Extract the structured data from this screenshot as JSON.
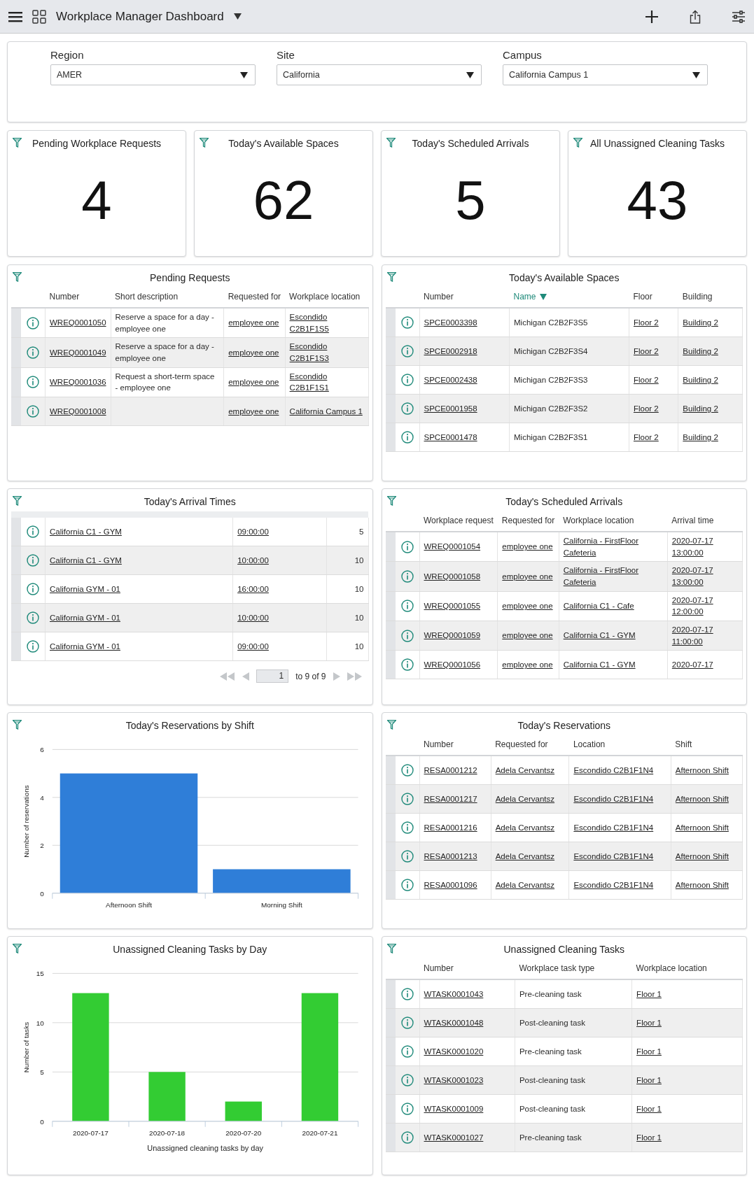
{
  "header": {
    "title": "Workplace Manager Dashboard"
  },
  "filters": [
    {
      "label": "Region",
      "value": "AMER"
    },
    {
      "label": "Site",
      "value": "California"
    },
    {
      "label": "Campus",
      "value": "California Campus 1"
    }
  ],
  "kpis": [
    {
      "title": "Pending Workplace Requests",
      "value": "4"
    },
    {
      "title": "Today's Available Spaces",
      "value": "62"
    },
    {
      "title": "Today's Scheduled Arrivals",
      "value": "5"
    },
    {
      "title": "All Unassigned Cleaning Tasks",
      "value": "43"
    }
  ],
  "panels": [
    {
      "kind": "table",
      "title": "Pending Requests",
      "columns": [
        {
          "label": "Number",
          "kind": "link"
        },
        {
          "label": "Short description",
          "kind": "text"
        },
        {
          "label": "Requested for",
          "kind": "link"
        },
        {
          "label": "Workplace location",
          "kind": "link"
        }
      ],
      "rows": [
        [
          "WREQ0001050",
          "Reserve a space for a day - employee one",
          "employee one",
          "Escondido C2B1F1S5"
        ],
        [
          "WREQ0001049",
          "Reserve a space for a day - employee one",
          "employee one",
          "Escondido C2B1F1S3"
        ],
        [
          "WREQ0001036",
          "Request a short-term space - employee one",
          "employee one",
          "Escondido C2B1F1S1"
        ],
        [
          "WREQ0001008",
          "",
          "employee one",
          "California Campus 1"
        ]
      ]
    },
    {
      "kind": "table",
      "title": "Today's Available Spaces",
      "columns": [
        {
          "label": "Number",
          "kind": "link",
          "sorted": false
        },
        {
          "label": "Name",
          "kind": "text",
          "sorted": true
        },
        {
          "label": "Floor",
          "kind": "link",
          "sorted": false
        },
        {
          "label": "Building",
          "kind": "link",
          "sorted": false
        }
      ],
      "rows": [
        [
          "SPCE0003398",
          "Michigan C2B2F3S5",
          "Floor 2",
          "Building 2"
        ],
        [
          "SPCE0002918",
          "Michigan C2B2F3S4",
          "Floor 2",
          "Building 2"
        ],
        [
          "SPCE0002438",
          "Michigan C2B2F3S3",
          "Floor 2",
          "Building 2"
        ],
        [
          "SPCE0001958",
          "Michigan C2B2F3S2",
          "Floor 2",
          "Building 2"
        ],
        [
          "SPCE0001478",
          "Michigan C2B2F3S1",
          "Floor 2",
          "Building 2"
        ]
      ]
    },
    {
      "kind": "table",
      "title": "Today's Arrival Times",
      "columns": [
        {
          "kind": "link"
        },
        {
          "kind": "link"
        },
        {
          "kind": "number"
        }
      ],
      "rows": [
        [
          "California C1 - GYM",
          "09:00:00",
          "5"
        ],
        [
          "California C1 - GYM",
          "10:00:00",
          "10"
        ],
        [
          "California GYM - 01",
          "16:00:00",
          "10"
        ],
        [
          "California GYM - 01",
          "10:00:00",
          "10"
        ],
        [
          "California GYM - 01",
          "09:00:00",
          "10"
        ]
      ],
      "pager": {
        "page": "1",
        "range": "to 9 of 9"
      }
    },
    {
      "kind": "table",
      "title": "Today's Scheduled Arrivals",
      "columns": [
        {
          "label": "Workplace request",
          "kind": "link"
        },
        {
          "label": "Requested for",
          "kind": "link"
        },
        {
          "label": "Workplace location",
          "kind": "link"
        },
        {
          "label": "Arrival time",
          "kind": "link"
        }
      ],
      "rows": [
        [
          "WREQ0001054",
          "employee one",
          "California - FirstFloor Cafeteria",
          "2020-07-17 13:00:00"
        ],
        [
          "WREQ0001058",
          "employee one",
          "California - FirstFloor Cafeteria",
          "2020-07-17 13:00:00"
        ],
        [
          "WREQ0001055",
          "employee one",
          "California C1 - Cafe",
          "2020-07-17 12:00:00"
        ],
        [
          "WREQ0001059",
          "employee one",
          "California C1 - GYM",
          "2020-07-17 11:00:00"
        ],
        [
          "WREQ0001056",
          "employee one",
          "California C1 - GYM",
          "2020-07-17"
        ]
      ]
    },
    {
      "kind": "chart",
      "title": "Today's Reservations by Shift",
      "chart_data": {
        "type": "bar",
        "ylabel": "Number of reservations",
        "categories": [
          "Afternoon Shift",
          "Morning Shift"
        ],
        "series": [
          {
            "color": "#2f7ed8",
            "values": [
              5,
              1
            ]
          }
        ],
        "ylim": [
          0,
          6
        ],
        "yticks": [
          0,
          2,
          4,
          6
        ]
      }
    },
    {
      "kind": "table",
      "title": "Today's Reservations",
      "columns": [
        {
          "label": "Number",
          "kind": "link"
        },
        {
          "label": "Requested for",
          "kind": "link"
        },
        {
          "label": "Location",
          "kind": "link"
        },
        {
          "label": "Shift",
          "kind": "link"
        }
      ],
      "rows": [
        [
          "RESA0001212",
          "Adela Cervantsz",
          "Escondido C2B1F1N4",
          "Afternoon Shift"
        ],
        [
          "RESA0001217",
          "Adela Cervantsz",
          "Escondido C2B1F1N4",
          "Afternoon Shift"
        ],
        [
          "RESA0001216",
          "Adela Cervantsz",
          "Escondido C2B1F1N4",
          "Afternoon Shift"
        ],
        [
          "RESA0001213",
          "Adela Cervantsz",
          "Escondido C2B1F1N4",
          "Afternoon Shift"
        ],
        [
          "RESA0001096",
          "Adela Cervantsz",
          "Escondido C2B1F1N4",
          "Afternoon Shift"
        ]
      ]
    },
    {
      "kind": "chart",
      "title": "Unassigned Cleaning Tasks by Day",
      "chart_data": {
        "type": "bar",
        "xlabel": "Unassigned cleaning tasks by day",
        "ylabel": "Number of tasks",
        "categories": [
          "2020-07-17",
          "2020-07-18",
          "2020-07-20",
          "2020-07-21"
        ],
        "series": [
          {
            "color": "#33cc33",
            "values": [
              13,
              5,
              2,
              13
            ]
          }
        ],
        "ylim": [
          0,
          15
        ],
        "yticks": [
          0,
          5,
          10,
          15
        ]
      }
    },
    {
      "kind": "table",
      "title": "Unassigned Cleaning Tasks",
      "columns": [
        {
          "label": "Number",
          "kind": "link"
        },
        {
          "label": "Workplace task type",
          "kind": "text"
        },
        {
          "label": "Workplace location",
          "kind": "link"
        }
      ],
      "rows": [
        [
          "WTASK0001043",
          "Pre-cleaning task",
          "Floor 1"
        ],
        [
          "WTASK0001048",
          "Post-cleaning task",
          "Floor 1"
        ],
        [
          "WTASK0001020",
          "Pre-cleaning task",
          "Floor 1"
        ],
        [
          "WTASK0001023",
          "Post-cleaning task",
          "Floor 1"
        ],
        [
          "WTASK0001009",
          "Post-cleaning task",
          "Floor 1"
        ],
        [
          "WTASK0001027",
          "Pre-cleaning task",
          "Floor 1"
        ]
      ]
    }
  ]
}
